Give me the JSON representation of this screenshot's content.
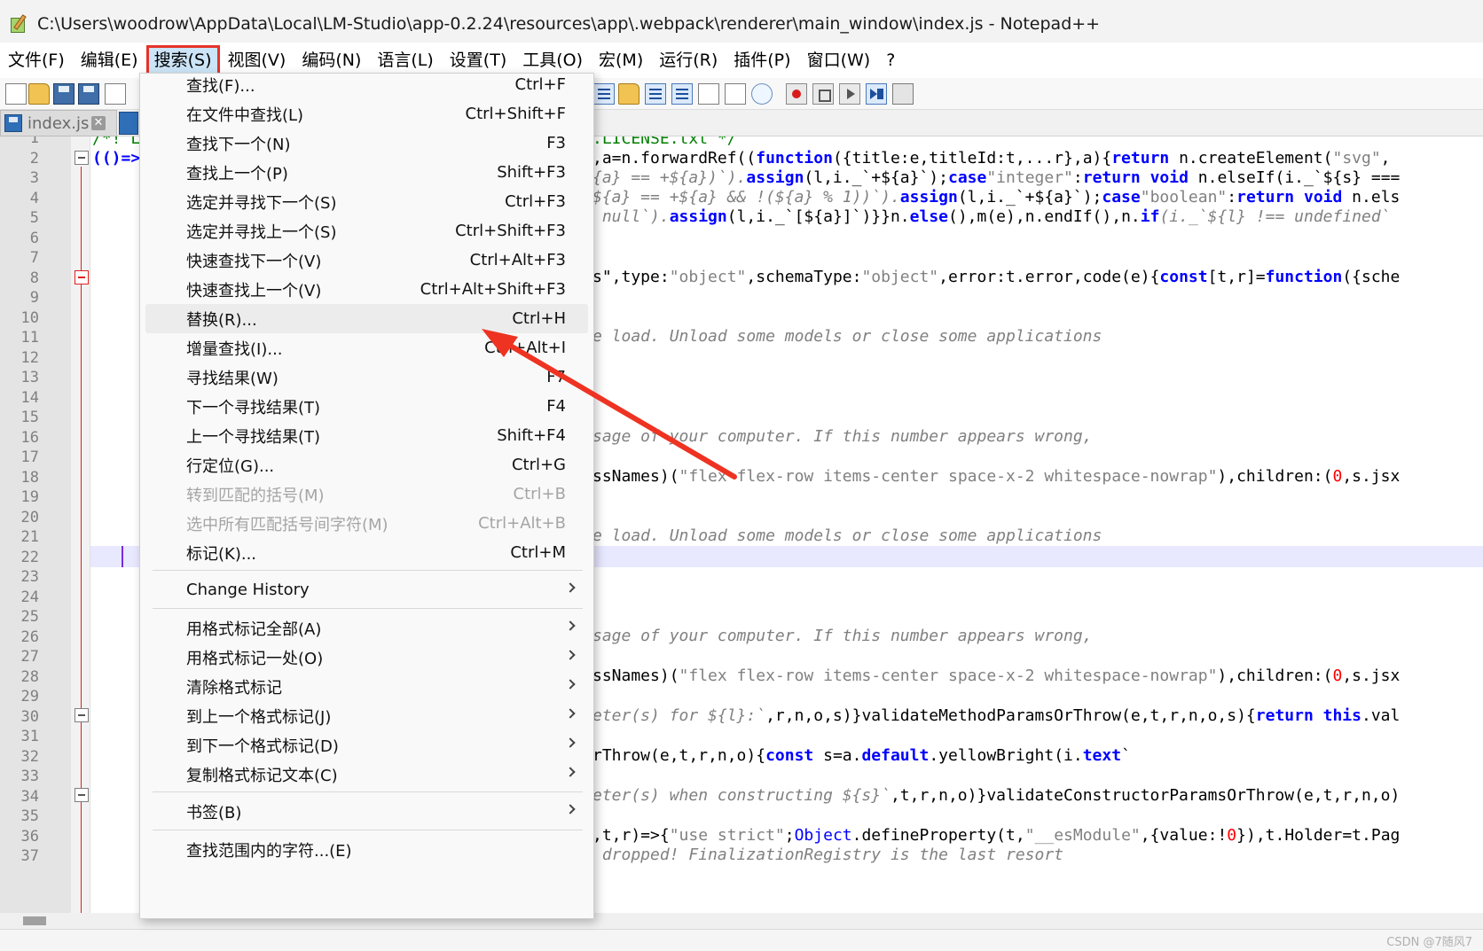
{
  "window": {
    "title": "C:\\Users\\woodrow\\AppData\\Local\\LM-Studio\\app-0.2.24\\resources\\app\\.webpack\\renderer\\main_window\\index.js - Notepad++"
  },
  "menubar": {
    "items": [
      {
        "label": "文件(F)"
      },
      {
        "label": "编辑(E)"
      },
      {
        "label": "搜索(S)",
        "active": true
      },
      {
        "label": "视图(V)"
      },
      {
        "label": "编码(N)"
      },
      {
        "label": "语言(L)"
      },
      {
        "label": "设置(T)"
      },
      {
        "label": "工具(O)"
      },
      {
        "label": "宏(M)"
      },
      {
        "label": "运行(R)"
      },
      {
        "label": "插件(P)"
      },
      {
        "label": "窗口(W)"
      },
      {
        "label": "?"
      }
    ]
  },
  "tabs": [
    {
      "label": "index.js",
      "close": "✕"
    }
  ],
  "search_menu": {
    "items": [
      {
        "label": "查找(F)...",
        "shortcut": "Ctrl+F"
      },
      {
        "label": "在文件中查找(L)",
        "shortcut": "Ctrl+Shift+F"
      },
      {
        "label": "查找下一个(N)",
        "shortcut": "F3"
      },
      {
        "label": "查找上一个(P)",
        "shortcut": "Shift+F3"
      },
      {
        "label": "选定并寻找下一个(S)",
        "shortcut": "Ctrl+F3"
      },
      {
        "label": "选定并寻找上一个(S)",
        "shortcut": "Ctrl+Shift+F3"
      },
      {
        "label": "快速查找下一个(V)",
        "shortcut": "Ctrl+Alt+F3"
      },
      {
        "label": "快速查找上一个(V)",
        "shortcut": "Ctrl+Alt+Shift+F3"
      },
      {
        "label": "替换(R)...",
        "shortcut": "Ctrl+H",
        "highlighted": true
      },
      {
        "label": "增量查找(I)...",
        "shortcut": "Ctrl+Alt+I"
      },
      {
        "label": "寻找结果(W)",
        "shortcut": "F7"
      },
      {
        "label": "下一个寻找结果(T)",
        "shortcut": "F4"
      },
      {
        "label": "上一个寻找结果(T)",
        "shortcut": "Shift+F4"
      },
      {
        "label": "行定位(G)...",
        "shortcut": "Ctrl+G"
      },
      {
        "label": "转到匹配的括号(M)",
        "shortcut": "Ctrl+B",
        "disabled": true
      },
      {
        "label": "选中所有匹配括号间字符(M)",
        "shortcut": "Ctrl+Alt+B",
        "disabled": true
      },
      {
        "label": "标记(K)...",
        "shortcut": "Ctrl+M"
      }
    ],
    "change_history": "Change History",
    "style_items": [
      {
        "label": "用格式标记全部(A)"
      },
      {
        "label": "用格式标记一处(O)"
      },
      {
        "label": "清除格式标记"
      },
      {
        "label": "到上一个格式标记(J)"
      },
      {
        "label": "到下一个格式标记(D)"
      },
      {
        "label": "复制格式标记文本(C)"
      }
    ],
    "bookmark": "书签(B)",
    "char_range": "查找范围内的字符...(E)"
  },
  "editor": {
    "line_numbers": [
      "1",
      "2",
      "3",
      "4",
      "5",
      "6",
      "7",
      "8",
      "9",
      "10",
      "11",
      "12",
      "13",
      "14",
      "15",
      "16",
      "17",
      "18",
      "19",
      "20",
      "21",
      "22",
      "23",
      "24",
      "25",
      "26",
      "27",
      "28",
      "29",
      "30",
      "31",
      "32",
      "33",
      "34",
      "35",
      "36",
      "37"
    ],
    "left_fragments": {
      "l1": "/*! L",
      "l2": "(()=>"
    },
    "code_lines": {
      "l1": ".LICENSE.txt */",
      "l2a": ",a=n.forwardRef((",
      "l2b": "function",
      "l2c": "({title:e,titleId:t,...r},a){",
      "l2d": "return",
      "l2e": " n.createElement(",
      "l2f": "\"svg\"",
      "l2g": ",",
      "l3a": "{a} == +${a})`).",
      "l3b": "assign",
      "l3c": "(l,i._`+${a}`);",
      "l3d": "case",
      "l3e": "\"integer\"",
      "l3f": ":",
      "l3g": "return void",
      "l3h": " n.elseIf(i._`${s} ===",
      "l4a": "${a} == +${a} && !(${a} % 1))`).",
      "l4b": "assign",
      "l4c": "(l,i._`+${a}`);",
      "l4d": "case",
      "l4e": "\"boolean\"",
      "l4f": ":",
      "l4g": "return void",
      "l4h": " n.els",
      "l5a": " null`).",
      "l5b": "assign",
      "l5c": "(l,i._`[${a}]`)}}n.",
      "l5d": "else",
      "l5e": "(),m(e),n.endIf(),n.",
      "l5f": "if",
      "l5g": "(i._`${l} !== undefined`",
      "l8a": "s\",type:",
      "l8b": "\"object\"",
      "l8c": ",schemaType:",
      "l8d": "\"object\"",
      "l8e": ",error:t.error,code(e){",
      "l8f": "const",
      "l8g": "[t,r]=",
      "l8h": "function",
      "l8i": "({sche",
      "l11": "e load. Unload some models or close some applications",
      "l16": "sage of your computer. If this number appears wrong,",
      "l18a": "ssNames)(",
      "l18b": "\"flex flex-row items-center space-x-2 whitespace-nowrap\"",
      "l18c": "),children:(",
      "l18d": "0",
      "l18e": ",s.jsx",
      "l21": "e load. Unload some models or close some applications",
      "l26": "sage of your computer. If this number appears wrong,",
      "l28a": "ssNames)(",
      "l28b": "\"flex flex-row items-center space-x-2 whitespace-nowrap\"",
      "l28c": "),children:(",
      "l28d": "0",
      "l28e": ",s.jsx",
      "l30a": "eter(s) for ${l}:`",
      "l30b": ",r,n,o,s)}validateMethodParamsOrThrow(e,t,r,n,o,s){",
      "l30c": "return this",
      "l30d": ".val",
      "l32a": "rThrow(e,t,r,n,o){",
      "l32b": "const",
      "l32c": " s=a.",
      "l32d": "default",
      "l32e": ".yellowBright(i.",
      "l32f": "text",
      "l32g": "`",
      "l34a": "eter(s) when constructing ${s}`",
      "l34b": ",t,r,n,o)}validateConstructorParamsOrThrow(e,t,r,n,o)",
      "l36a": ",t,r)=>{",
      "l36b": "\"use strict\"",
      "l36c": ";",
      "l36d": "Object",
      "l36e": ".defineProperty(t,",
      "l36f": "\"__esModule\"",
      "l36g": ",{value:!",
      "l36h": "0",
      "l36i": "}),t.Holder=t.Pag",
      "l37": " dropped! FinalizationRegistry is the last resort"
    }
  },
  "watermark": "CSDN @7随风7",
  "colors": {
    "menu_highlight_border": "#e5332a",
    "annotation_arrow": "#ee3322",
    "keyword": "#0000ff",
    "comment": "#008000",
    "string": "#808080",
    "number": "#ff0000"
  }
}
